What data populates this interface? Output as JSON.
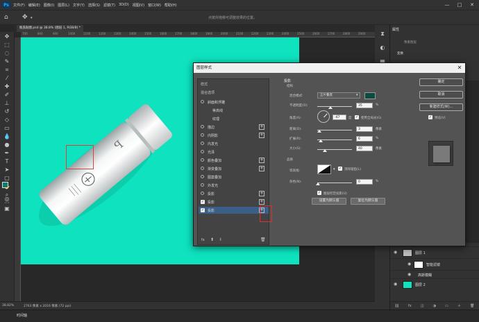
{
  "app": {
    "logo": "Ps"
  },
  "menu": [
    "文件(F)",
    "编辑(E)",
    "图像(I)",
    "图层(L)",
    "文字(Y)",
    "选择(S)",
    "滤镜(T)",
    "3D(D)",
    "视图(V)",
    "窗口(W)",
    "帮助(H)"
  ],
  "window_controls": {
    "minimize": "—",
    "maximize": "□",
    "close": "✕"
  },
  "options_bar": {
    "hint": "点按并拖移可调整效果的位置。"
  },
  "document_tab": {
    "label": "瓶盖贴图.psd @ 38.8% (图层 1, RGB/8) *"
  },
  "ruler": {
    "ticks": [
      "700",
      "800",
      "900",
      "1000",
      "1100",
      "1200",
      "1300",
      "1400",
      "1500",
      "1600",
      "1700",
      "1800",
      "1900",
      "2000",
      "2100",
      "2200",
      "2300",
      "2400",
      "2500",
      "2600",
      "2700",
      "2800",
      "2900"
    ]
  },
  "status": {
    "zoom": "38.82%",
    "doc_info": "2763 像素 x 2016 像素 (72 ppi)"
  },
  "timeline": {
    "label": "时间轴"
  },
  "properties": {
    "tab": "属性",
    "doc_label": "像素图层",
    "section": "变换"
  },
  "layers": [
    {
      "name": "图层 1",
      "type": "smart"
    },
    {
      "name": "智能滤镜",
      "type": "filter"
    },
    {
      "name": "高斯模糊",
      "type": "filter-item"
    },
    {
      "name": "图层 2",
      "type": "fill",
      "color": "#0ee2be"
    }
  ],
  "dialog": {
    "title": "图层样式",
    "left": {
      "styles_header": "样式",
      "blend_header": "混合选项",
      "effects": [
        {
          "label": "斜面和浮雕",
          "checked": false,
          "plus": false
        },
        {
          "label": "等高线",
          "checked": false,
          "plus": false,
          "indent": true
        },
        {
          "label": "纹理",
          "checked": false,
          "plus": false,
          "indent": true
        },
        {
          "label": "描边",
          "checked": false,
          "plus": true
        },
        {
          "label": "内阴影",
          "checked": false,
          "plus": true
        },
        {
          "label": "内发光",
          "checked": false,
          "plus": false
        },
        {
          "label": "光泽",
          "checked": false,
          "plus": false
        },
        {
          "label": "颜色叠加",
          "checked": false,
          "plus": true
        },
        {
          "label": "渐变叠加",
          "checked": false,
          "plus": true
        },
        {
          "label": "图案叠加",
          "checked": false,
          "plus": false
        },
        {
          "label": "外发光",
          "checked": false,
          "plus": false
        },
        {
          "label": "投影",
          "checked": false,
          "plus": true
        },
        {
          "label": "投影",
          "checked": true,
          "plus": true
        },
        {
          "label": "投影",
          "checked": true,
          "plus": true,
          "selected": true
        }
      ],
      "footer": {
        "fx": "fx",
        "up": "⬆",
        "down": "⬇",
        "trash": "🗑"
      }
    },
    "shadow": {
      "title": "投影",
      "structure": "结构",
      "blend_mode_label": "混合模式:",
      "blend_mode": "正片叠底",
      "blend_color": "#0f4a40",
      "opacity_label": "不透明度(O):",
      "opacity": "35",
      "angle_label": "角度(A):",
      "angle": "-47",
      "angle_unit": "度",
      "global_light": "使用全局光(G)",
      "distance_label": "距离(D):",
      "distance": "3",
      "spread_label": "扩展(R):",
      "spread": "6",
      "size_label": "大小(S):",
      "size": "40",
      "unit_px": "像素",
      "unit_pct": "%",
      "quality": "品质",
      "contour_label": "等高线:",
      "anti_alias": "消除锯齿(L)",
      "noise_label": "杂色(N):",
      "noise": "0",
      "knockout": "图层挖空投影(U)",
      "make_default": "设置为默认值",
      "reset_default": "复位为默认值"
    },
    "buttons": {
      "ok": "确定",
      "cancel": "取消",
      "new_style": "新建样式(W)...",
      "preview": "预览(V)"
    }
  }
}
